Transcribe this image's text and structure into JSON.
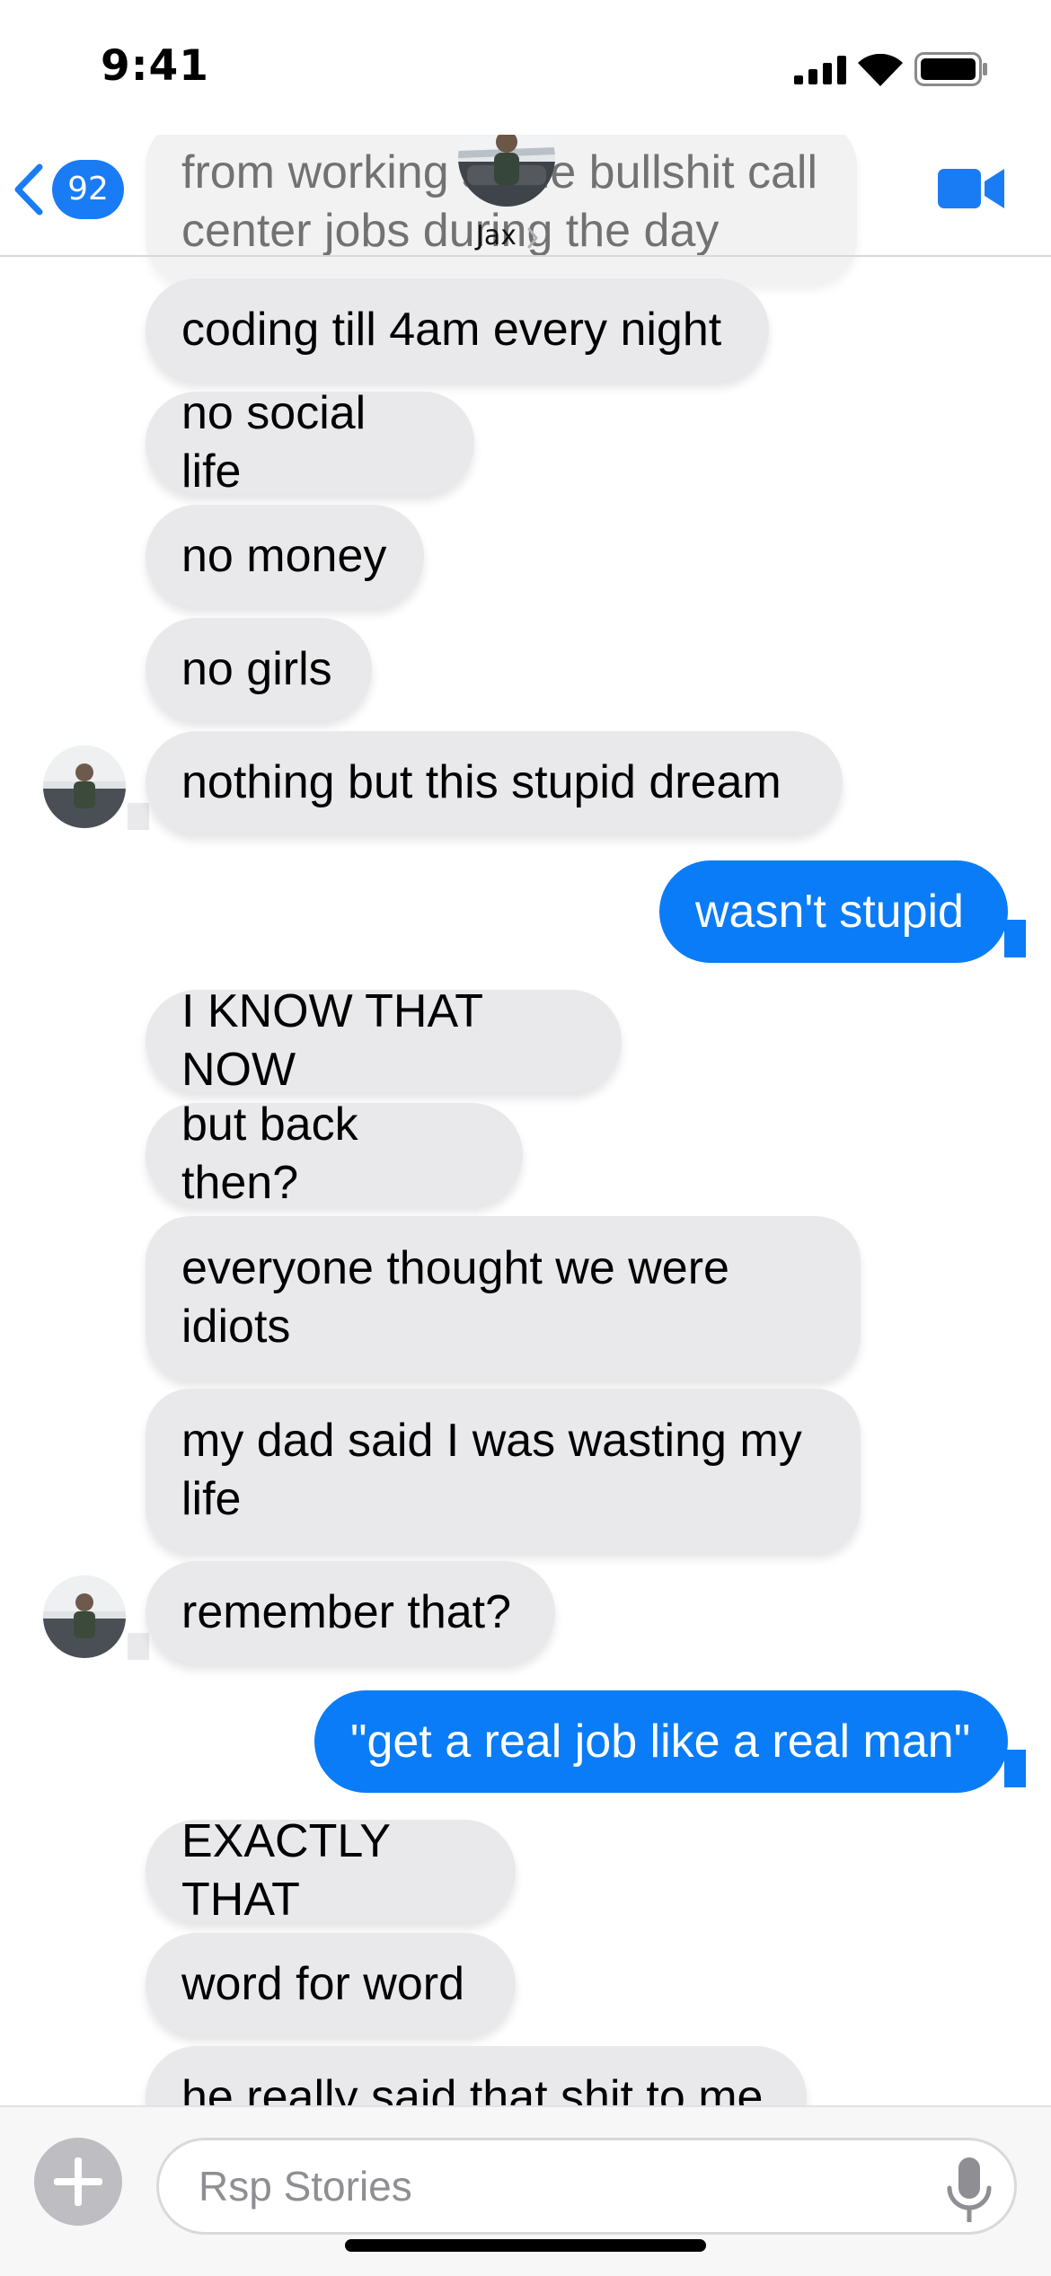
{
  "status_bar": {
    "time": "9:41"
  },
  "header": {
    "unread_count": "92",
    "contact_name": "Jax"
  },
  "messages": [
    {
      "side": "in",
      "text": "from working some bullshit call center jobs during the day"
    },
    {
      "side": "in",
      "text": "coding till 4am every night"
    },
    {
      "side": "in",
      "text": "no social life"
    },
    {
      "side": "in",
      "text": "no money"
    },
    {
      "side": "in",
      "text": "no girls"
    },
    {
      "side": "in",
      "text": "nothing but this stupid dream"
    },
    {
      "side": "out",
      "text": "wasn't stupid"
    },
    {
      "side": "in",
      "text": "I KNOW THAT NOW"
    },
    {
      "side": "in",
      "text": "but back then?"
    },
    {
      "side": "in",
      "text": "everyone thought we were idiots"
    },
    {
      "side": "in",
      "text": "my dad said I was wasting my life"
    },
    {
      "side": "in",
      "text": "remember that?"
    },
    {
      "side": "out",
      "text": "\"get a real job like a real man\""
    },
    {
      "side": "in",
      "text": "EXACTLY THAT"
    },
    {
      "side": "in",
      "text": "word for word"
    },
    {
      "side": "in",
      "text": "he really said that shit to me"
    }
  ],
  "composer": {
    "placeholder": "Rsp Stories"
  },
  "colors": {
    "accent": "#0a7cf7",
    "incoming_bubble": "#e9e9eb",
    "badge": "#1a7cf5"
  },
  "icons": [
    "back-chevron-icon",
    "video-camera-icon",
    "plus-icon",
    "microphone-icon",
    "signal-icon",
    "wifi-icon",
    "battery-icon"
  ]
}
